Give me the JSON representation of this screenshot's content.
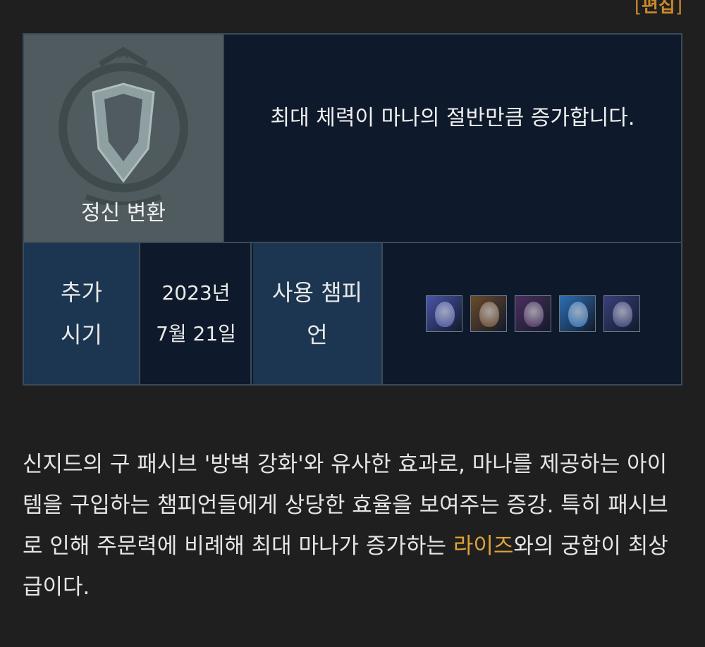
{
  "edit_link": {
    "open": "[",
    "label": "편집",
    "close": "]"
  },
  "rune": {
    "name": "정신 변환",
    "icon": "shield-rune-icon",
    "description": "최대 체력이 마나의 절반만큼 증가합니다."
  },
  "info": {
    "added_label": "추가 시기",
    "added_value": "2023년 7월 21일",
    "champions_label": "사용 챔피언",
    "champions": [
      {
        "icon": "ryze-portrait-icon",
        "color": "#4a55a8"
      },
      {
        "icon": "cassiopeia-portrait-icon",
        "color": "#6b4a2a"
      },
      {
        "icon": "kassadin-portrait-icon",
        "color": "#4b2f5e"
      },
      {
        "icon": "anivia-portrait-icon",
        "color": "#2e6fb3"
      },
      {
        "icon": "singed-portrait-icon",
        "color": "#3a3f7a"
      }
    ]
  },
  "body": {
    "part1": "신지드의 구 패시브 '방벽 강화'와 유사한 효과로, 마나를 제공하는 아이템을 구입하는 챔피언들에게 상당한 효율을 보여주는 증강. 특히 패시브로 인해 주문력에 비례해 최대 마나가 증가하는 ",
    "link": "라이즈",
    "part2": "와의 궁합이 최상급이다."
  }
}
